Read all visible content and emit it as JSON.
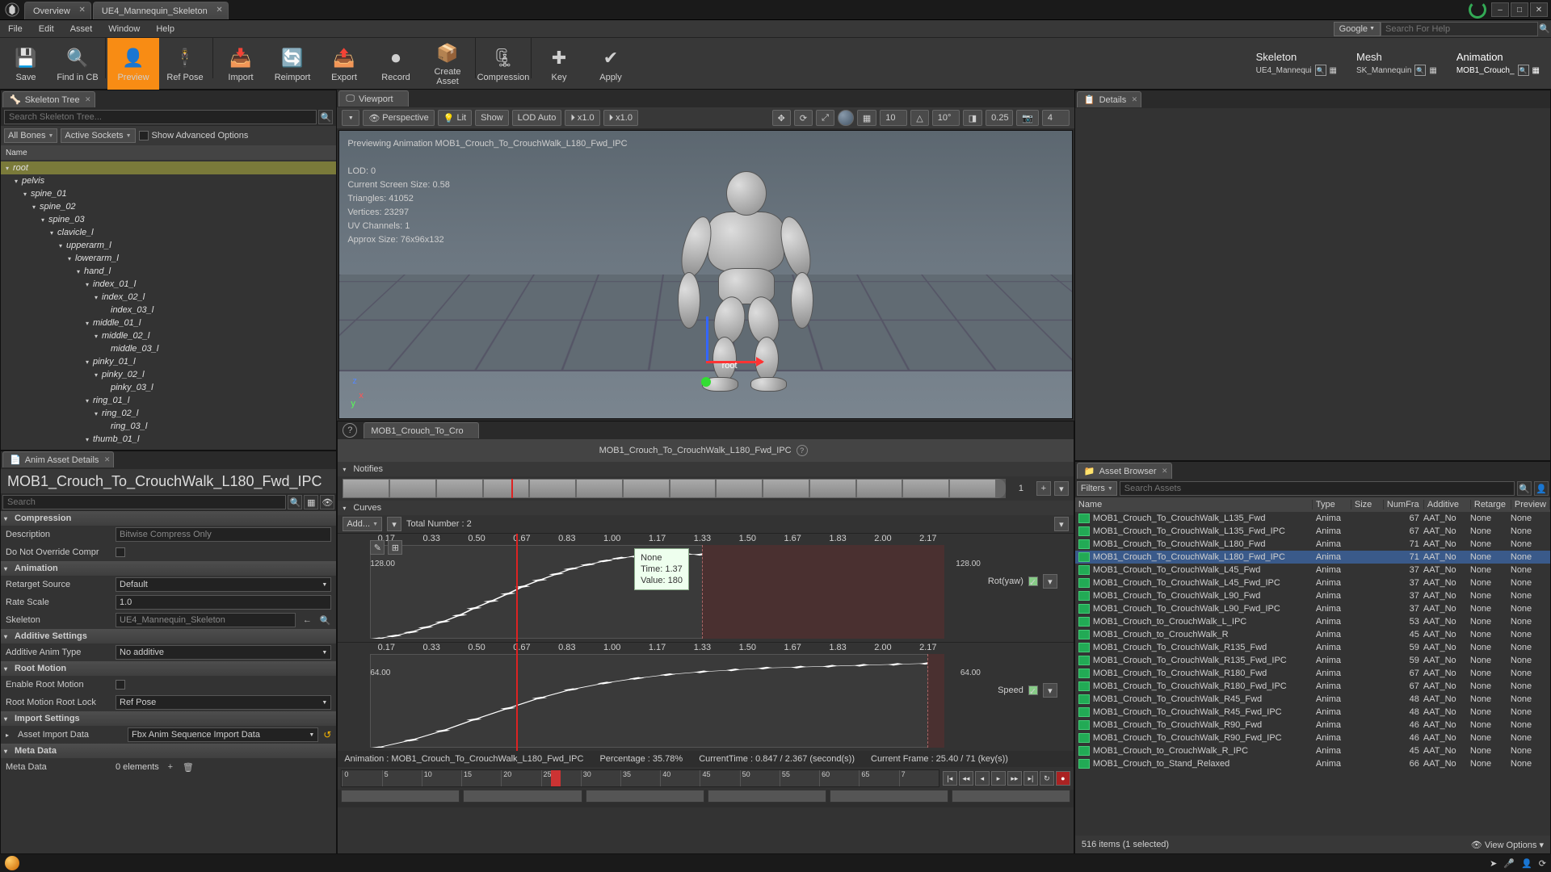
{
  "title_tabs": [
    "Overview",
    "UE4_Mannequin_Skeleton"
  ],
  "win_controls": [
    "–",
    "□",
    "✕"
  ],
  "menus": [
    "File",
    "Edit",
    "Asset",
    "Window",
    "Help"
  ],
  "google_label": "Google",
  "help_search_ph": "Search For Help",
  "toolbar": [
    {
      "label": "Save",
      "icon": "💾"
    },
    {
      "label": "Find in CB",
      "icon": "🔍"
    },
    {
      "label": "Preview",
      "icon": "👤",
      "active": true
    },
    {
      "label": "Ref Pose",
      "icon": "🕴"
    },
    {
      "label": "Import",
      "icon": "📥"
    },
    {
      "label": "Reimport",
      "icon": "🔄"
    },
    {
      "label": "Export",
      "icon": "📤"
    },
    {
      "label": "Record",
      "icon": "⏺"
    },
    {
      "label": "Create Asset",
      "icon": "📦"
    },
    {
      "label": "Compression",
      "icon": "🗜"
    },
    {
      "label": "Key",
      "icon": "✚"
    },
    {
      "label": "Apply",
      "icon": "✔",
      "dim": true
    }
  ],
  "breadcrumbs": [
    {
      "title": "Skeleton",
      "sub": "UE4_Mannequi"
    },
    {
      "title": "Mesh",
      "sub": "SK_Mannequin"
    },
    {
      "title": "Animation",
      "sub": "MOB1_Crouch_",
      "active": true
    }
  ],
  "panel_skel_tree": "Skeleton Tree",
  "skel_search_ph": "Search Skeleton Tree...",
  "skel_dd1": "All Bones",
  "skel_dd2": "Active Sockets",
  "skel_show_adv": "Show Advanced Options",
  "skel_col": "Name",
  "skel_tree": [
    {
      "d": 0,
      "n": "root",
      "sel": true
    },
    {
      "d": 1,
      "n": "pelvis"
    },
    {
      "d": 2,
      "n": "spine_01"
    },
    {
      "d": 3,
      "n": "spine_02"
    },
    {
      "d": 4,
      "n": "spine_03"
    },
    {
      "d": 5,
      "n": "clavicle_l"
    },
    {
      "d": 6,
      "n": "upperarm_l"
    },
    {
      "d": 7,
      "n": "lowerarm_l"
    },
    {
      "d": 8,
      "n": "hand_l"
    },
    {
      "d": 9,
      "n": "index_01_l"
    },
    {
      "d": 10,
      "n": "index_02_l"
    },
    {
      "d": 11,
      "n": "index_03_l",
      "leaf": true
    },
    {
      "d": 9,
      "n": "middle_01_l"
    },
    {
      "d": 10,
      "n": "middle_02_l"
    },
    {
      "d": 11,
      "n": "middle_03_l",
      "leaf": true
    },
    {
      "d": 9,
      "n": "pinky_01_l"
    },
    {
      "d": 10,
      "n": "pinky_02_l"
    },
    {
      "d": 11,
      "n": "pinky_03_l",
      "leaf": true
    },
    {
      "d": 9,
      "n": "ring_01_l"
    },
    {
      "d": 10,
      "n": "ring_02_l"
    },
    {
      "d": 11,
      "n": "ring_03_l",
      "leaf": true
    },
    {
      "d": 9,
      "n": "thumb_01_l"
    }
  ],
  "panel_aad": "Anim Asset Details",
  "aad_title": "MOB1_Crouch_To_CrouchWalk_L180_Fwd_IPC",
  "aad_search_ph": "Search",
  "sections": [
    {
      "title": "Compression",
      "rows": [
        {
          "label": "Description",
          "type": "text",
          "value": "Bitwise Compress Only",
          "readonly": true
        },
        {
          "label": "Do Not Override Compr",
          "type": "check",
          "value": false
        }
      ]
    },
    {
      "title": "Animation",
      "rows": [
        {
          "label": "Retarget Source",
          "type": "dd",
          "value": "Default"
        },
        {
          "label": "Rate Scale",
          "type": "num",
          "value": "1.0"
        },
        {
          "label": "Skeleton",
          "type": "asset",
          "value": "UE4_Mannequin_Skeleton"
        }
      ]
    },
    {
      "title": "Additive Settings",
      "rows": [
        {
          "label": "Additive Anim Type",
          "type": "dd",
          "value": "No additive"
        }
      ]
    },
    {
      "title": "Root Motion",
      "rows": [
        {
          "label": "Enable Root Motion",
          "type": "check",
          "value": false
        },
        {
          "label": "Root Motion Root Lock",
          "type": "dd",
          "value": "Ref Pose"
        }
      ]
    },
    {
      "title": "Import Settings",
      "rows": [
        {
          "label": "Asset Import Data",
          "type": "dd",
          "value": "Fbx Anim Sequence Import Data",
          "expand": true,
          "reset": true
        }
      ]
    },
    {
      "title": "Meta Data",
      "rows": [
        {
          "label": "Meta Data",
          "type": "array",
          "value": "0 elements"
        }
      ]
    }
  ],
  "panel_viewport": "Viewport",
  "vp_btns": {
    "persp": "Perspective",
    "lit": "Lit",
    "show": "Show",
    "lod": "LOD Auto",
    "x1a": "x1.0",
    "x1b": "x1.0",
    "grid": "10",
    "angle": "10°",
    "scale": "0.25",
    "last": "4"
  },
  "vp_overlay": {
    "preview": "Previewing Animation MOB1_Crouch_To_CrouchWalk_L180_Fwd_IPC",
    "lines": [
      "LOD: 0",
      "Current Screen Size: 0.58",
      "Triangles: 41052",
      "Vertices: 23297",
      "UV Channels: 1",
      "Approx Size: 76x96x132"
    ]
  },
  "root_label": "root",
  "anim_tab": "MOB1_Crouch_To_Cro",
  "anim_big_name": "MOB1_Crouch_To_CrouchWalk_L180_Fwd_IPC",
  "notifies_label": "Notifies",
  "notif_track_label": "1",
  "curves_label": "Curves",
  "curves_add": "Add...",
  "curves_total": "Total Number : 2",
  "curve_ticks": [
    "0.17",
    "0.33",
    "0.50",
    "0.67",
    "0.83",
    "1.00",
    "1.17",
    "1.33",
    "1.50",
    "1.67",
    "1.83",
    "2.00",
    "2.17"
  ],
  "curve1": {
    "lval": "128.00",
    "rval": "128.00",
    "name": "Rot(yaw)"
  },
  "curve2": {
    "lval": "64.00",
    "rval": "64.00",
    "name": "Speed"
  },
  "tooltip": {
    "l1": "None",
    "l2": "Time: 1.37",
    "l3": "Value: 180"
  },
  "anim_status": {
    "name": "Animation :   MOB1_Crouch_To_CrouchWalk_L180_Fwd_IPC",
    "pct": "Percentage :  35.78%",
    "time": "CurrentTime :   0.847 / 2.367 (second(s))",
    "frame": "Current Frame :   25.40 / 71 (key(s))"
  },
  "timeline_ticks": [
    "0",
    "5",
    "10",
    "15",
    "20",
    "25",
    "30",
    "35",
    "40",
    "45",
    "50",
    "55",
    "60",
    "65",
    "7"
  ],
  "panel_details": "Details",
  "panel_asset_browser": "Asset Browser",
  "ab_filters": "Filters",
  "ab_search_ph": "Search Assets",
  "ab_cols": [
    "Name",
    "Type",
    "Size",
    "NumFra",
    "Additive",
    "Retarge",
    "Preview"
  ],
  "ab_rows": [
    {
      "n": "MOB1_Crouch_To_CrouchWalk_L135_Fwd",
      "t": "Anima",
      "s": "",
      "nf": "67",
      "a": "AAT_No",
      "r": "None",
      "p": "None"
    },
    {
      "n": "MOB1_Crouch_To_CrouchWalk_L135_Fwd_IPC",
      "t": "Anima",
      "s": "",
      "nf": "67",
      "a": "AAT_No",
      "r": "None",
      "p": "None"
    },
    {
      "n": "MOB1_Crouch_To_CrouchWalk_L180_Fwd",
      "t": "Anima",
      "s": "",
      "nf": "71",
      "a": "AAT_No",
      "r": "None",
      "p": "None"
    },
    {
      "n": "MOB1_Crouch_To_CrouchWalk_L180_Fwd_IPC",
      "t": "Anima",
      "s": "",
      "nf": "71",
      "a": "AAT_No",
      "r": "None",
      "p": "None",
      "sel": true
    },
    {
      "n": "MOB1_Crouch_To_CrouchWalk_L45_Fwd",
      "t": "Anima",
      "s": "",
      "nf": "37",
      "a": "AAT_No",
      "r": "None",
      "p": "None"
    },
    {
      "n": "MOB1_Crouch_To_CrouchWalk_L45_Fwd_IPC",
      "t": "Anima",
      "s": "",
      "nf": "37",
      "a": "AAT_No",
      "r": "None",
      "p": "None"
    },
    {
      "n": "MOB1_Crouch_To_CrouchWalk_L90_Fwd",
      "t": "Anima",
      "s": "",
      "nf": "37",
      "a": "AAT_No",
      "r": "None",
      "p": "None"
    },
    {
      "n": "MOB1_Crouch_To_CrouchWalk_L90_Fwd_IPC",
      "t": "Anima",
      "s": "",
      "nf": "37",
      "a": "AAT_No",
      "r": "None",
      "p": "None"
    },
    {
      "n": "MOB1_Crouch_to_CrouchWalk_L_IPC",
      "t": "Anima",
      "s": "",
      "nf": "53",
      "a": "AAT_No",
      "r": "None",
      "p": "None"
    },
    {
      "n": "MOB1_Crouch_to_CrouchWalk_R",
      "t": "Anima",
      "s": "",
      "nf": "45",
      "a": "AAT_No",
      "r": "None",
      "p": "None"
    },
    {
      "n": "MOB1_Crouch_To_CrouchWalk_R135_Fwd",
      "t": "Anima",
      "s": "",
      "nf": "59",
      "a": "AAT_No",
      "r": "None",
      "p": "None"
    },
    {
      "n": "MOB1_Crouch_To_CrouchWalk_R135_Fwd_IPC",
      "t": "Anima",
      "s": "",
      "nf": "59",
      "a": "AAT_No",
      "r": "None",
      "p": "None"
    },
    {
      "n": "MOB1_Crouch_To_CrouchWalk_R180_Fwd",
      "t": "Anima",
      "s": "",
      "nf": "67",
      "a": "AAT_No",
      "r": "None",
      "p": "None"
    },
    {
      "n": "MOB1_Crouch_To_CrouchWalk_R180_Fwd_IPC",
      "t": "Anima",
      "s": "",
      "nf": "67",
      "a": "AAT_No",
      "r": "None",
      "p": "None"
    },
    {
      "n": "MOB1_Crouch_To_CrouchWalk_R45_Fwd",
      "t": "Anima",
      "s": "",
      "nf": "48",
      "a": "AAT_No",
      "r": "None",
      "p": "None"
    },
    {
      "n": "MOB1_Crouch_To_CrouchWalk_R45_Fwd_IPC",
      "t": "Anima",
      "s": "",
      "nf": "48",
      "a": "AAT_No",
      "r": "None",
      "p": "None"
    },
    {
      "n": "MOB1_Crouch_To_CrouchWalk_R90_Fwd",
      "t": "Anima",
      "s": "",
      "nf": "46",
      "a": "AAT_No",
      "r": "None",
      "p": "None"
    },
    {
      "n": "MOB1_Crouch_To_CrouchWalk_R90_Fwd_IPC",
      "t": "Anima",
      "s": "",
      "nf": "46",
      "a": "AAT_No",
      "r": "None",
      "p": "None"
    },
    {
      "n": "MOB1_Crouch_to_CrouchWalk_R_IPC",
      "t": "Anima",
      "s": "",
      "nf": "45",
      "a": "AAT_No",
      "r": "None",
      "p": "None"
    },
    {
      "n": "MOB1_Crouch_to_Stand_Relaxed",
      "t": "Anima",
      "s": "",
      "nf": "66",
      "a": "AAT_No",
      "r": "None",
      "p": "None"
    }
  ],
  "ab_footer": "516 items (1 selected)",
  "ab_view": "View Options",
  "chart_data": [
    {
      "type": "line",
      "title": "Rot(yaw)",
      "xlabel": "",
      "ylabel": "",
      "ylim": [
        0,
        180
      ],
      "x": [
        0.03,
        0.1,
        0.17,
        0.23,
        0.3,
        0.37,
        0.43,
        0.5,
        0.57,
        0.63,
        0.7,
        0.77,
        0.83,
        0.9,
        0.97,
        1.03,
        1.1,
        1.17,
        1.23,
        1.3,
        1.37
      ],
      "values": [
        0,
        6,
        14,
        24,
        36,
        50,
        65,
        80,
        96,
        111,
        125,
        138,
        149,
        158,
        166,
        172,
        176,
        178,
        179,
        180,
        180
      ]
    },
    {
      "type": "line",
      "title": "Speed",
      "xlabel": "",
      "ylabel": "",
      "ylim": [
        0,
        90
      ],
      "x": [
        0.03,
        0.17,
        0.3,
        0.43,
        0.57,
        0.7,
        0.83,
        0.97,
        1.1,
        1.23,
        1.37,
        1.5,
        1.63,
        1.77,
        1.9,
        2.03,
        2.17,
        2.3
      ],
      "values": [
        0,
        8,
        18,
        30,
        42,
        53,
        62,
        69,
        74,
        78,
        81,
        83,
        85,
        86,
        87,
        88,
        89,
        90
      ]
    }
  ],
  "playhead_pct": 35.78
}
